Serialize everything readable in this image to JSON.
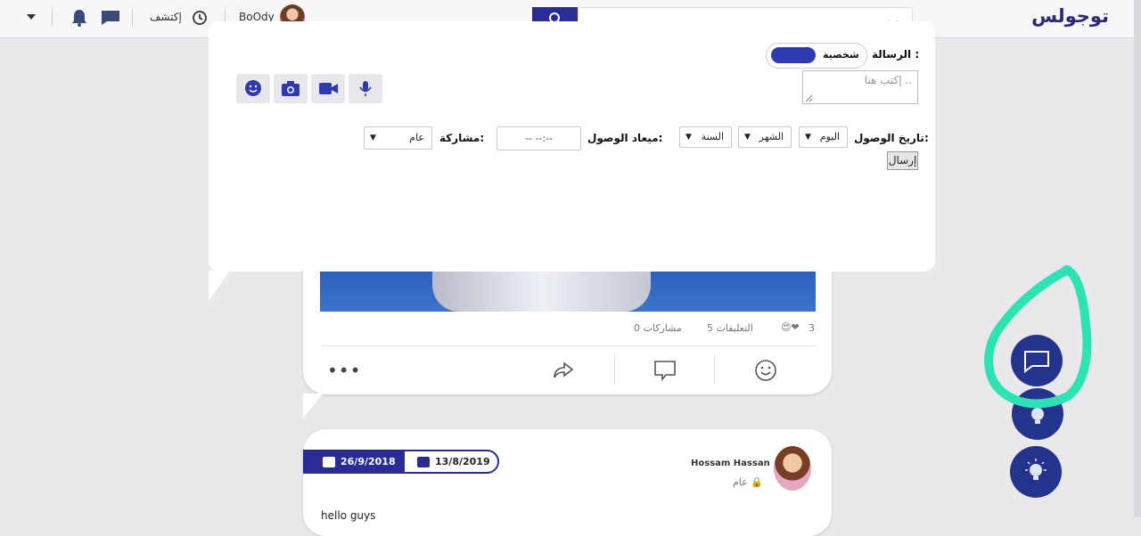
{
  "header": {
    "logo": "توجولس",
    "search_placeholder": "بحث",
    "user_name": "BoOdy",
    "explore_label": "إكتشف"
  },
  "post1": {
    "reactions_count": "3",
    "comments": "5 التعليقات",
    "shares": "0 مشاركات"
  },
  "post2": {
    "author": "Hossam Hassan",
    "privacy": "عام",
    "date_created": "13/8/2019",
    "date_due": "26/9/2018",
    "text": "hello guys"
  },
  "modal": {
    "message_label": "الرسالة :",
    "toggle_label": "شخصية",
    "textarea_placeholder": "إكتب هنا ..",
    "arrival_date_label": "تاريخ الوصول:",
    "day_select": "اليوم",
    "month_select": "الشهر",
    "year_select": "السنة",
    "arrival_time_label": "ميعاد الوصول:",
    "time_value": "-- --:--",
    "share_label": "مشاركة:",
    "share_select": "عام",
    "send_button": "إرسال"
  },
  "colors": {
    "brand": "#2a2b93",
    "fab": "#24338c",
    "highlight": "#2de3b4"
  }
}
